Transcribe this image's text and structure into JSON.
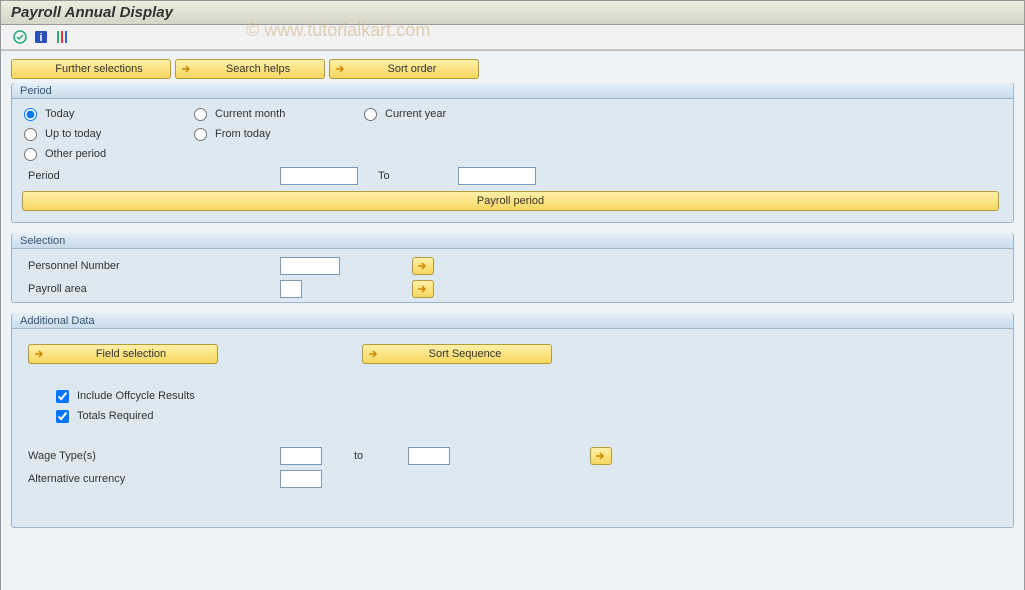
{
  "title": "Payroll Annual Display",
  "watermark": "© www.tutorialkart.com",
  "topButtons": {
    "further": "Further selections",
    "searchHelps": "Search helps",
    "sortOrder": "Sort order"
  },
  "period": {
    "legend": "Period",
    "today": "Today",
    "currentMonth": "Current month",
    "currentYear": "Current year",
    "upToToday": "Up to today",
    "fromToday": "From today",
    "otherPeriod": "Other period",
    "periodLabel": "Period",
    "toLabel": "To",
    "payrollPeriodBtn": "Payroll period",
    "selected": "today"
  },
  "selection": {
    "legend": "Selection",
    "personnelNumber": "Personnel Number",
    "payrollArea": "Payroll area"
  },
  "additional": {
    "legend": "Additional Data",
    "fieldSelection": "Field selection",
    "sortSequence": "Sort Sequence",
    "includeOffcycle": "Include Offcycle Results",
    "totalsRequired": "Totals Required",
    "wageTypes": "Wage Type(s)",
    "toLabel": "to",
    "altCurrency": "Alternative currency",
    "chk_includeOffcycle": true,
    "chk_totalsRequired": true
  }
}
